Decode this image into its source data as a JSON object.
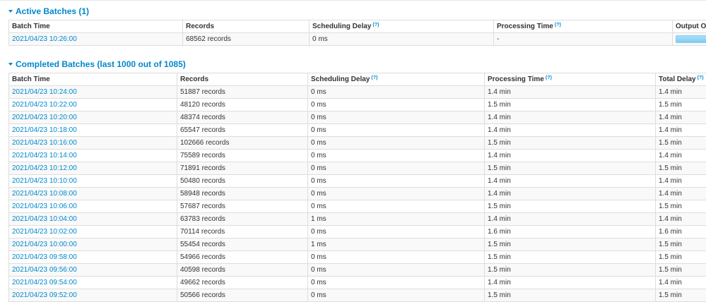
{
  "active": {
    "title": "Active Batches (1)",
    "columns": {
      "batch_time": "Batch Time",
      "records": "Records",
      "scheduling_delay": "Scheduling Delay",
      "processing_time": "Processing Time",
      "output_op": "Output Op"
    },
    "help_mark": "(?)",
    "rows": [
      {
        "batch_time": "2021/04/23 10:26:00",
        "records": "68562 records",
        "scheduling_delay": "0 ms",
        "processing_time": "-",
        "output_progress": 0
      }
    ]
  },
  "completed": {
    "title": "Completed Batches (last 1000 out of 1085)",
    "columns": {
      "batch_time": "Batch Time",
      "records": "Records",
      "scheduling_delay": "Scheduling Delay",
      "processing_time": "Processing Time",
      "total_delay": "Total Delay"
    },
    "help_mark": "(?)",
    "rows": [
      {
        "batch_time": "2021/04/23 10:24:00",
        "records": "51887 records",
        "scheduling_delay": "0 ms",
        "processing_time": "1.4 min",
        "total_delay": "1.4 min"
      },
      {
        "batch_time": "2021/04/23 10:22:00",
        "records": "48120 records",
        "scheduling_delay": "0 ms",
        "processing_time": "1.5 min",
        "total_delay": "1.5 min"
      },
      {
        "batch_time": "2021/04/23 10:20:00",
        "records": "48374 records",
        "scheduling_delay": "0 ms",
        "processing_time": "1.4 min",
        "total_delay": "1.4 min"
      },
      {
        "batch_time": "2021/04/23 10:18:00",
        "records": "65547 records",
        "scheduling_delay": "0 ms",
        "processing_time": "1.4 min",
        "total_delay": "1.4 min"
      },
      {
        "batch_time": "2021/04/23 10:16:00",
        "records": "102666 records",
        "scheduling_delay": "0 ms",
        "processing_time": "1.5 min",
        "total_delay": "1.5 min"
      },
      {
        "batch_time": "2021/04/23 10:14:00",
        "records": "75589 records",
        "scheduling_delay": "0 ms",
        "processing_time": "1.4 min",
        "total_delay": "1.4 min"
      },
      {
        "batch_time": "2021/04/23 10:12:00",
        "records": "71891 records",
        "scheduling_delay": "0 ms",
        "processing_time": "1.5 min",
        "total_delay": "1.5 min"
      },
      {
        "batch_time": "2021/04/23 10:10:00",
        "records": "50480 records",
        "scheduling_delay": "0 ms",
        "processing_time": "1.4 min",
        "total_delay": "1.4 min"
      },
      {
        "batch_time": "2021/04/23 10:08:00",
        "records": "58948 records",
        "scheduling_delay": "0 ms",
        "processing_time": "1.4 min",
        "total_delay": "1.4 min"
      },
      {
        "batch_time": "2021/04/23 10:06:00",
        "records": "57687 records",
        "scheduling_delay": "0 ms",
        "processing_time": "1.5 min",
        "total_delay": "1.5 min"
      },
      {
        "batch_time": "2021/04/23 10:04:00",
        "records": "63783 records",
        "scheduling_delay": "1 ms",
        "processing_time": "1.4 min",
        "total_delay": "1.4 min"
      },
      {
        "batch_time": "2021/04/23 10:02:00",
        "records": "70114 records",
        "scheduling_delay": "0 ms",
        "processing_time": "1.6 min",
        "total_delay": "1.6 min"
      },
      {
        "batch_time": "2021/04/23 10:00:00",
        "records": "55454 records",
        "scheduling_delay": "1 ms",
        "processing_time": "1.5 min",
        "total_delay": "1.5 min"
      },
      {
        "batch_time": "2021/04/23 09:58:00",
        "records": "54966 records",
        "scheduling_delay": "0 ms",
        "processing_time": "1.5 min",
        "total_delay": "1.5 min"
      },
      {
        "batch_time": "2021/04/23 09:56:00",
        "records": "40598 records",
        "scheduling_delay": "0 ms",
        "processing_time": "1.5 min",
        "total_delay": "1.5 min"
      },
      {
        "batch_time": "2021/04/23 09:54:00",
        "records": "49662 records",
        "scheduling_delay": "0 ms",
        "processing_time": "1.4 min",
        "total_delay": "1.4 min"
      },
      {
        "batch_time": "2021/04/23 09:52:00",
        "records": "50566 records",
        "scheduling_delay": "0 ms",
        "processing_time": "1.5 min",
        "total_delay": "1.5 min"
      }
    ]
  }
}
